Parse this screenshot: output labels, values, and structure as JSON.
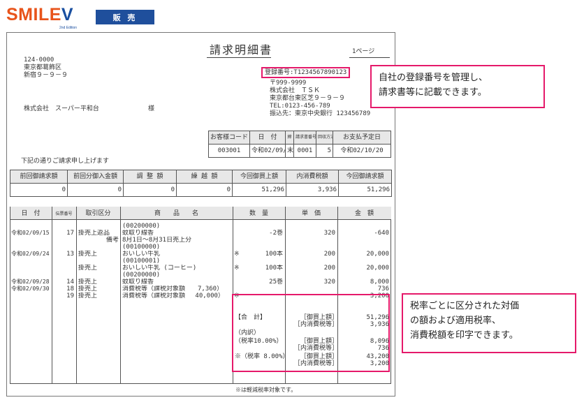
{
  "brand": {
    "logo_main": "SMILE",
    "logo_v": "V",
    "edition": "2nd Edition",
    "badge": "販 売"
  },
  "invoice": {
    "title": "請求明細書",
    "page": "1ページ",
    "customer_zip": "124-0000",
    "customer_addr1": "東京都葛飾区",
    "customer_addr2": "新宿９－９－９",
    "customer_name": "株式会社　スーパー平和台",
    "honorific": "様",
    "reg_no": "登録番号:T1234567890123",
    "issuer_zip": "〒999-9999",
    "issuer_name": "株式会社　ＴＳＫ",
    "issuer_addr": "東京都台東区芝９－９－９",
    "issuer_tel": "TEL:0123-456-789",
    "issuer_bank": "振込先：東京中央銀行 123456789",
    "greeting": "下記の通りご請求申し上げます",
    "info_headers": [
      "お客様コード",
      "日　付",
      "締",
      "請求書番号",
      "回収方法",
      "お支払予定日"
    ],
    "info_values": [
      "003001",
      "令和02/09/30",
      "末",
      "0001",
      "5",
      "令和02/10/20"
    ],
    "summary_headers": [
      "前回御請求額",
      "前回分御入金額",
      "調 整 額",
      "繰 越 額",
      "今回御買上額",
      "内消費税額",
      "今回御請求額"
    ],
    "summary_values": [
      "0",
      "0",
      "0",
      "0",
      "51,296",
      "3,936",
      "51,296"
    ],
    "detail_headers": [
      "日　付",
      "伝票番号",
      "取引区分",
      "商　　品　　名",
      "数　量",
      "単　価",
      "金　額"
    ],
    "rows": [
      {
        "date": "",
        "slip": "",
        "kind": "",
        "name": "(00200000)",
        "mark": "",
        "qty": "",
        "price": "",
        "amount": ""
      },
      {
        "date": "令和02/09/15",
        "slip": "17",
        "kind": "掛売上返品",
        "name": "蚊取り線香",
        "mark": "",
        "qty": "-2巻",
        "price": "320",
        "amount": "-640"
      },
      {
        "date": "",
        "slip": "",
        "kind": "備考",
        "name": "8月1日～8月31日売上分",
        "mark": "",
        "qty": "",
        "price": "",
        "amount": ""
      },
      {
        "date": "",
        "slip": "",
        "kind": "",
        "name": "(00100000)",
        "mark": "",
        "qty": "",
        "price": "",
        "amount": ""
      },
      {
        "date": "令和02/09/24",
        "slip": "13",
        "kind": "掛売上",
        "name": "おいしい牛乳",
        "mark": "※",
        "qty": "100本",
        "price": "200",
        "amount": "20,000"
      },
      {
        "date": "",
        "slip": "",
        "kind": "",
        "name": "(00100001)",
        "mark": "",
        "qty": "",
        "price": "",
        "amount": ""
      },
      {
        "date": "",
        "slip": "",
        "kind": "掛売上",
        "name": "おいしい牛乳 (コーヒー)",
        "mark": "※",
        "qty": "100本",
        "price": "200",
        "amount": "20,000"
      },
      {
        "date": "",
        "slip": "",
        "kind": "",
        "name": "(00200000)",
        "mark": "",
        "qty": "",
        "price": "",
        "amount": ""
      },
      {
        "date": "令和02/09/28",
        "slip": "14",
        "kind": "掛売上",
        "name": "蚊取り線香",
        "mark": "",
        "qty": "25巻",
        "price": "320",
        "amount": "8,000"
      },
      {
        "date": "令和02/09/30",
        "slip": "18",
        "kind": "掛売上",
        "name": "消費税等（課税対象額　　7,360）",
        "mark": "",
        "qty": "",
        "price": "",
        "amount": "736"
      },
      {
        "date": "",
        "slip": "19",
        "kind": "掛売上",
        "name": "消費税等（課税対象額　 40,000）",
        "mark": "※",
        "qty": "",
        "price": "",
        "amount": "3,200"
      }
    ],
    "totals": [
      {
        "label": "【合　計】",
        "tag": "［御買上額］",
        "amount": "51,296"
      },
      {
        "label": "",
        "tag": "［内消費税等］",
        "amount": "3,936"
      },
      {
        "label": "（内訳）",
        "tag": "",
        "amount": ""
      },
      {
        "label": "（税率10.00%）",
        "tag": "［御買上額］",
        "amount": "8,096"
      },
      {
        "label": "",
        "tag": "［内消費税等］",
        "amount": "736"
      },
      {
        "label": "※（税率 8.00%）",
        "tag": "［御買上額］",
        "amount": "43,200"
      },
      {
        "label": "",
        "tag": "［内消費税等］",
        "amount": "3,200"
      }
    ],
    "footnote": "※は軽減税率対象です。"
  },
  "callouts": {
    "top": [
      "自社の登録番号を管理し、",
      "請求書等に記載できます。"
    ],
    "bottom": [
      "税率ごとに区分された対価",
      "の額および適用税率、",
      "消費税額を印字できます。"
    ]
  },
  "colors": {
    "brand_orange": "#e8541b",
    "brand_blue": "#1f4f9c",
    "highlight_pink": "#e5196a"
  }
}
